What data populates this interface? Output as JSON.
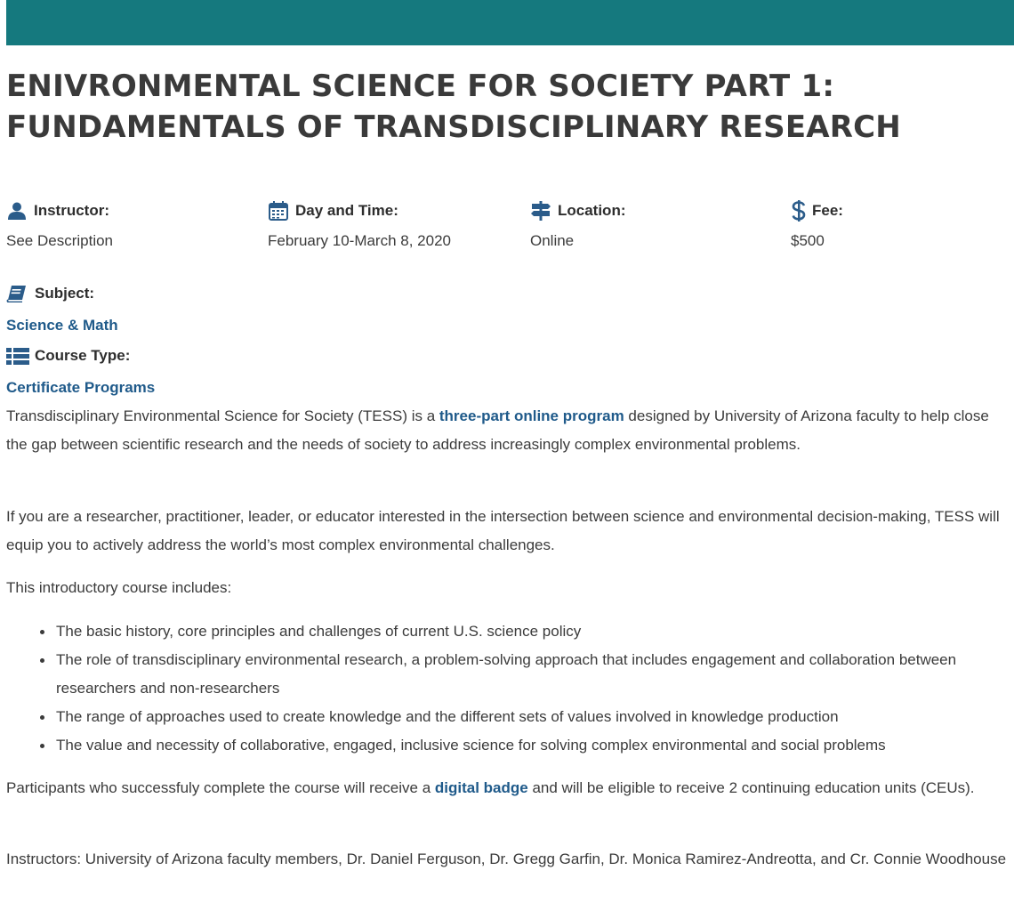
{
  "title": {
    "line1": "ENIVRONMENTAL SCIENCE FOR SOCIETY PART 1:",
    "line2": "FUNDAMENTALS OF TRANSDISCIPLINARY RESEARCH"
  },
  "details": {
    "instructor": {
      "label": "Instructor:",
      "value": "See Description",
      "icon": "user-icon"
    },
    "day_time": {
      "label": "Day and Time:",
      "value": "February 10-March 8, 2020",
      "icon": "calendar-icon"
    },
    "location": {
      "label": "Location:",
      "value": "Online",
      "icon": "signpost-icon"
    },
    "fee": {
      "label": "Fee:",
      "value": "$500",
      "icon": "dollar-icon"
    }
  },
  "subject": {
    "label": "Subject:",
    "value": "Science & Math",
    "icon": "book-icon"
  },
  "course_type": {
    "label": "Course Type:",
    "value": "Certificate Programs",
    "icon": "list-icon"
  },
  "description": {
    "p1_before": "Transdisciplinary Environmental Science for Society (TESS) is a ",
    "p1_link": "three-part online program",
    "p1_after": " designed by University of Arizona faculty to help close the gap between scientific research and the needs of society to address increasingly complex environmental problems.",
    "p2": "If you are a researcher, practitioner, leader, or educator interested in the intersection between science and environmental decision-making, TESS will equip you to actively address the world’s most complex environmental challenges.",
    "p3": "This introductory course includes:",
    "list": [
      "The basic history, core principles and challenges of current U.S. science policy",
      "The role of transdisciplinary environmental research, a problem-solving approach that includes engagement and collaboration between researchers and non-researchers",
      "The range of approaches used to create knowledge and the different sets of values involved in knowledge production",
      "The value and necessity of collaborative, engaged, inclusive science for solving complex environmental and social problems"
    ],
    "p4_before": "Participants who successfuly complete the course will receive a ",
    "p4_link": "digital badge",
    "p4_after": " and will be eligible to receive 2 continuing education units (CEUs).",
    "p5": "Instructors: University of Arizona faculty members, Dr. Daniel Ferguson, Dr. Gregg Garfin, Dr. Monica Ramirez-Andreotta, and Cr. Connie Woodhouse"
  },
  "colors": {
    "header_bar": "#15797e",
    "link": "#1f5a8a",
    "icon": "#2b5c8a"
  }
}
